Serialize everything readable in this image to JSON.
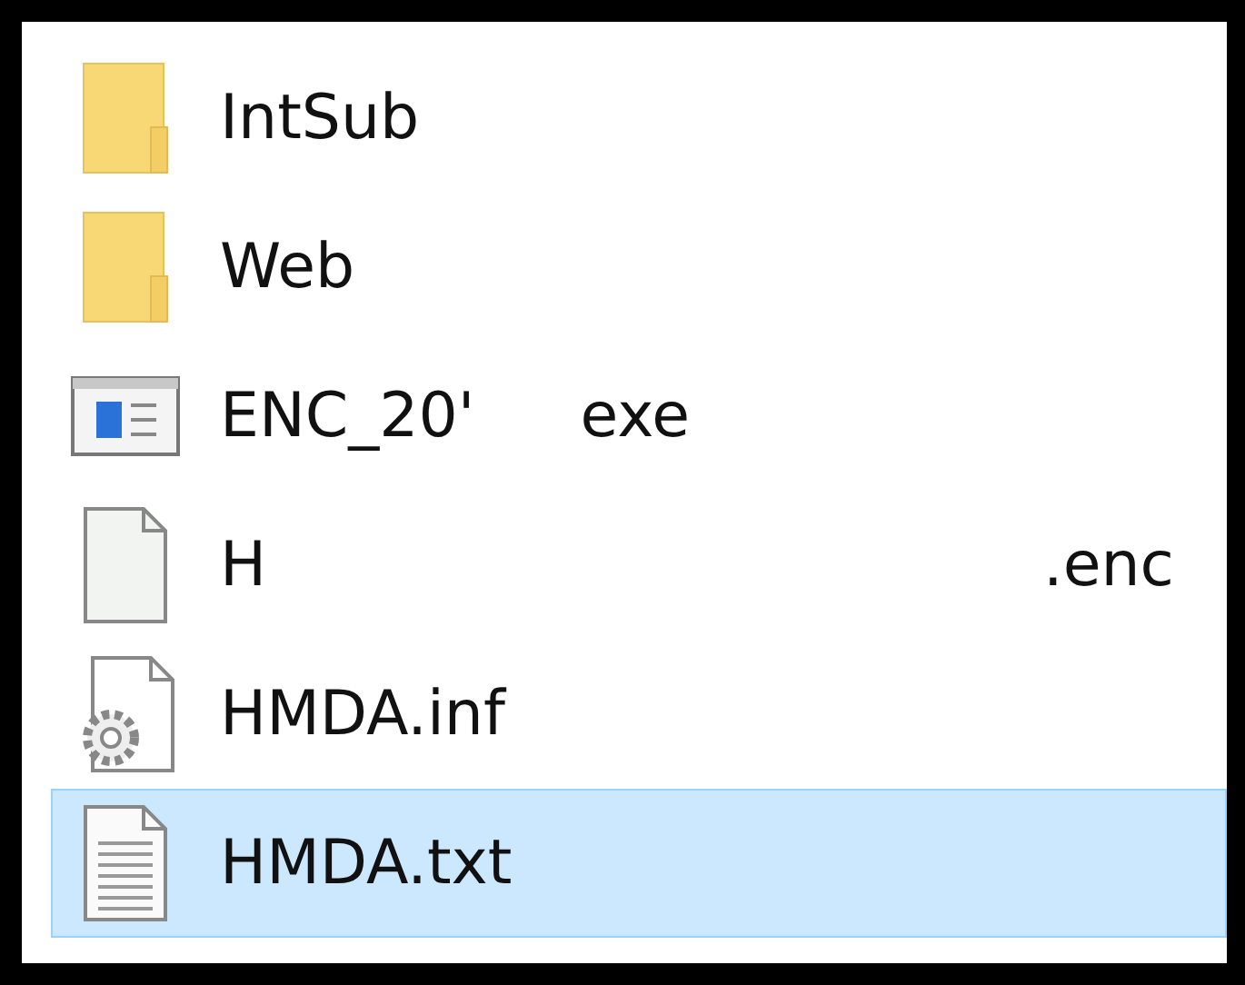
{
  "files": [
    {
      "kind": "folder",
      "name": "IntSub",
      "selected": false
    },
    {
      "kind": "folder",
      "name": "Web",
      "selected": false
    },
    {
      "kind": "application",
      "name": "ENC_20'",
      "tail": "exe",
      "selected": false
    },
    {
      "kind": "blank-file",
      "name": "H",
      "tail": ".enc",
      "selected": false
    },
    {
      "kind": "settings-file",
      "name": "HMDA.inf",
      "selected": false
    },
    {
      "kind": "text-file",
      "name": "HMDA.txt",
      "selected": true
    }
  ]
}
